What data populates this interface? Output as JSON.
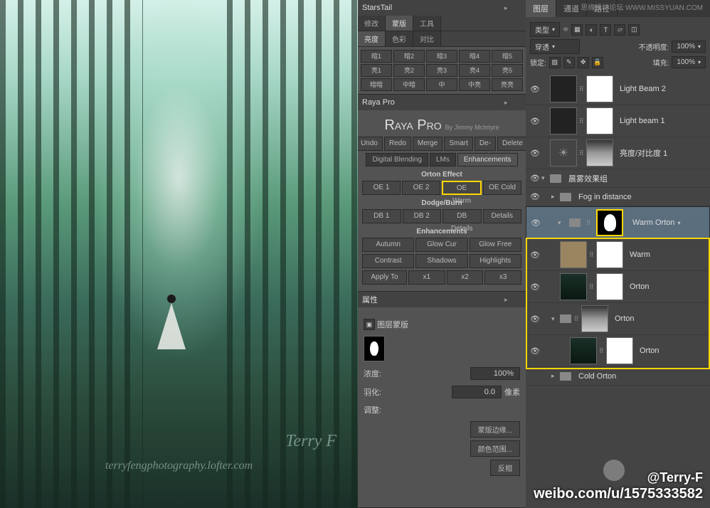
{
  "watermark_top": "思缘设计论坛  WWW.MISSYUAN.COM",
  "canvas": {
    "sig": "Terry F",
    "url": "terryfengphotography.lofter.com"
  },
  "starstail": {
    "title": "StarsTail",
    "tabs1": [
      "修改",
      "蒙版",
      "工具"
    ],
    "tabs2": [
      "亮度",
      "色彩",
      "对比"
    ],
    "grid": [
      "暗1",
      "暗2",
      "暗3",
      "暗4",
      "暗5",
      "亮1",
      "亮2",
      "亮3",
      "亮4",
      "亮5",
      "暗暗",
      "中暗",
      "中",
      "中亮",
      "亮亮"
    ]
  },
  "raya": {
    "title": "Raya Pro",
    "heading": "Raya Pro",
    "byline": "By Jimmy McIntyre",
    "row1": [
      "Undo",
      "Redo",
      "Merge",
      "Smart",
      "De-sel",
      "Delete"
    ],
    "tabs": [
      "Digital Blending",
      "LMs",
      "Enhancements"
    ],
    "sect1": "Orton Effect",
    "orton": [
      "OE 1",
      "OE 2",
      "OE Warm",
      "OE Cold"
    ],
    "sect2": "Dodge/Burn",
    "db": [
      "DB 1",
      "DB 2",
      "DB Details",
      "Details"
    ],
    "sect3": "Enhancements",
    "enh1": [
      "Autumn",
      "Glow Cur",
      "Glow Free"
    ],
    "enh2": [
      "Contrast",
      "Shadows",
      "Highlights"
    ],
    "apply": "Apply To",
    "applyopts": [
      "x1",
      "x2",
      "x3"
    ]
  },
  "props": {
    "title": "属性",
    "type": "图层蒙版",
    "density_l": "浓度:",
    "density_v": "100%",
    "feather_l": "羽化:",
    "feather_v": "0.0",
    "feather_u": "像素",
    "adjust": "调整:",
    "btns": [
      "蒙版边缘...",
      "颜色范围...",
      "反相"
    ]
  },
  "layers": {
    "tabs": [
      "图层",
      "通道",
      "路径"
    ],
    "kind": "类型",
    "blend": "穿透",
    "opacity_l": "不透明度:",
    "opacity_v": "100%",
    "lock_l": "锁定:",
    "fill_l": "填充:",
    "fill_v": "100%",
    "items": [
      {
        "name": "Light Beam 2",
        "mask": "blob"
      },
      {
        "name": "Light beam 1",
        "mask": "blob"
      },
      {
        "name": "亮度/对比度 1",
        "adj": true,
        "mask": "grad"
      },
      {
        "name": "晨雾效果组",
        "group": true
      },
      {
        "name": "Fog in distance",
        "group": true,
        "sub": true
      },
      {
        "name": "Warm Orton",
        "group": true,
        "sub": true,
        "sel": true,
        "mask": "blob"
      },
      {
        "name": "Warm",
        "thumb": "warm",
        "mask": "white",
        "sub": true
      },
      {
        "name": "Orton",
        "thumb": "forest",
        "mask": "white",
        "sub": true
      },
      {
        "name": "Orton",
        "group": true,
        "sub": true,
        "mask": "grad"
      },
      {
        "name": "Orton",
        "thumb": "forest",
        "mask": "white",
        "sub2": true
      },
      {
        "name": "Cold Orton",
        "group": true,
        "sub": true,
        "faint": true
      }
    ]
  },
  "credit": {
    "handle": "@Terry-F",
    "url": "weibo.com/u/1575333582"
  }
}
